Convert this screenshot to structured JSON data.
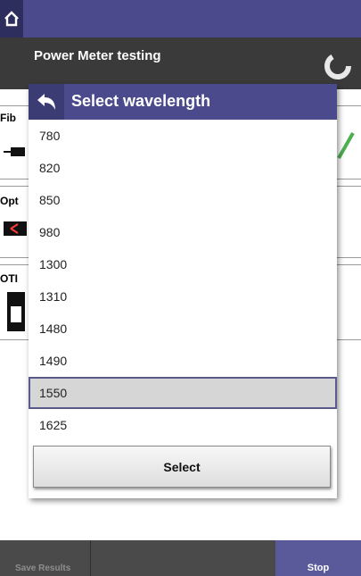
{
  "topbar": {
    "home_icon": "home-icon"
  },
  "header": {
    "title": "Power Meter testing"
  },
  "sections": [
    {
      "label": "Fib"
    },
    {
      "label": "Opt"
    },
    {
      "label": "OTI"
    }
  ],
  "bottombar": {
    "save_label": "Save Results",
    "stop_label": "Stop"
  },
  "dialog": {
    "title": "Select wavelength",
    "items": [
      "780",
      "820",
      "850",
      "980",
      "1300",
      "1310",
      "1480",
      "1490",
      "1550",
      "1625"
    ],
    "selected": "1550",
    "select_label": "Select"
  },
  "colors": {
    "accent": "#4a4a8c",
    "header_bg": "#3a3a3a",
    "check_green": "#4caf50"
  }
}
